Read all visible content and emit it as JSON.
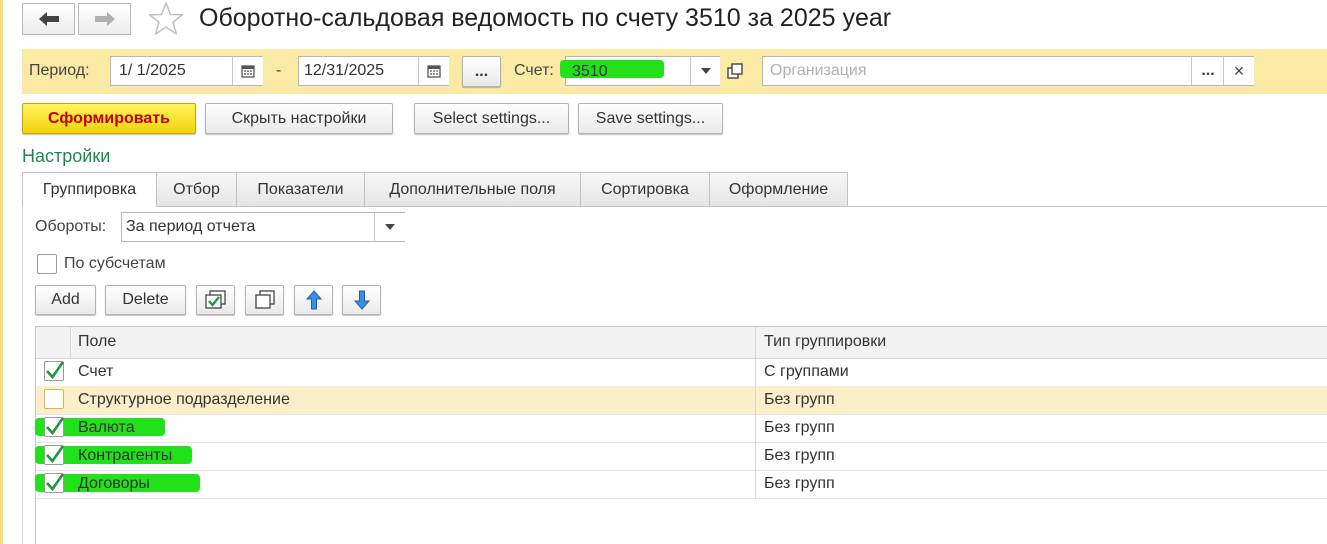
{
  "window": {
    "title": "Оборотно-сальдовая ведомость по счету 3510  за 2025 year"
  },
  "nav": {
    "back_icon": "arrow-left-icon",
    "forward_icon": "arrow-right-icon",
    "favorite_icon": "star-icon"
  },
  "params": {
    "period_label": "Период:",
    "date_from": "1/ 1/2025",
    "dash": "-",
    "date_to": "12/31/2025",
    "period_picker_label": "...",
    "account_label": "Счет:",
    "account_value": "3510",
    "organization_placeholder": "Организация",
    "organization_select_label": "...",
    "organization_clear_label": "×"
  },
  "toolbar": {
    "generate_label": "Сформировать",
    "hide_settings_label": "Скрыть настройки",
    "select_settings_label": "Select settings...",
    "save_settings_label": "Save settings..."
  },
  "settings": {
    "title": "Настройки",
    "tabs": [
      "Группировка",
      "Отбор",
      "Показатели",
      "Дополнительные поля",
      "Сортировка",
      "Оформление"
    ],
    "active_tab": 0,
    "turnover_label": "Обороты:",
    "turnover_value": "За период отчета",
    "subaccounts_label": "По субсчетам",
    "add_label": "Add",
    "delete_label": "Delete"
  },
  "grid": {
    "columns": [
      "Поле",
      "Тип группировки"
    ],
    "rows": [
      {
        "field": "Счет",
        "type": "С группами",
        "checked": true,
        "highlight": false,
        "selected": false
      },
      {
        "field": "Структурное подразделение",
        "type": "Без групп",
        "checked": false,
        "highlight": false,
        "selected": true
      },
      {
        "field": "Валюта",
        "type": "Без групп",
        "checked": true,
        "highlight": true,
        "selected": false
      },
      {
        "field": "Контрагенты",
        "type": "Без групп",
        "checked": true,
        "highlight": true,
        "selected": false
      },
      {
        "field": "Договоры",
        "type": "Без групп",
        "checked": true,
        "highlight": true,
        "selected": false
      }
    ]
  },
  "colors": {
    "param_bar": "#faeaa5",
    "primary_button": "#f2d20a",
    "primary_text": "#c00000",
    "settings_title": "#1d8a4b",
    "highlight": "#22e01a",
    "selected_row": "#fbeec9",
    "checkmark": "#1a9a3a"
  }
}
